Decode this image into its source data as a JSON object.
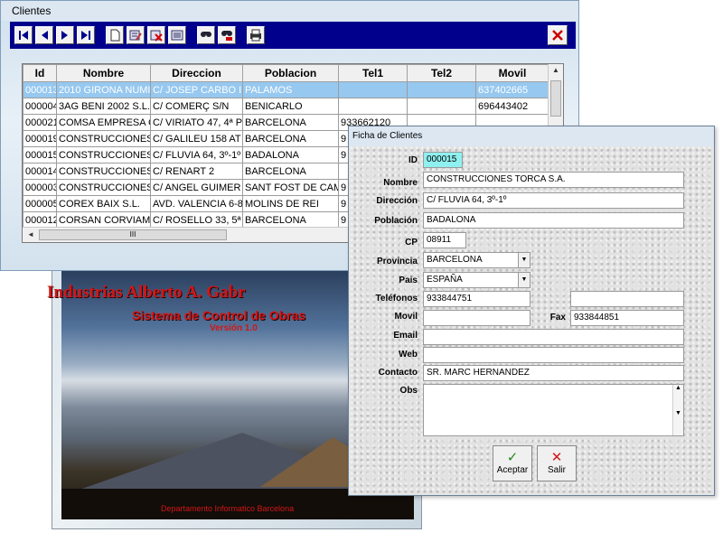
{
  "clientes_window": {
    "title": "Clientes",
    "toolbar": {
      "icons": [
        "first-icon",
        "prev-icon",
        "next-icon",
        "last-icon",
        "new-icon",
        "edit-icon",
        "delete-icon",
        "list-icon",
        "search-icon",
        "search-filter-icon",
        "print-icon",
        "close-icon"
      ]
    },
    "grid": {
      "columns": [
        "Id",
        "Nombre",
        "Direccion",
        "Poblacion",
        "Tel1",
        "Tel2",
        "Movil"
      ],
      "rows": [
        [
          "000013",
          "2010 GIRONA NUMI",
          "C/ JOSEP CARBO I",
          "PALAMOS",
          "",
          "",
          "637402665"
        ],
        [
          "000004",
          "3AG BENI 2002 S.L.",
          "C/ COMERÇ S/N",
          "BENICARLO",
          "",
          "",
          "696443402"
        ],
        [
          "000021",
          "COMSA EMPRESA C",
          "C/ VIRIATO 47, 4ª P",
          "BARCELONA",
          "933662120",
          "",
          ""
        ],
        [
          "000019",
          "CONSTRUCCIONES",
          "C/ GALILEU 158 AT",
          "BARCELONA",
          "9",
          "",
          ""
        ],
        [
          "000015",
          "CONSTRUCCIONES",
          "C/ FLUVIA 64, 3º-1º",
          "BADALONA",
          "9",
          "",
          ""
        ],
        [
          "000014",
          "CONSTRUCCIONES",
          "C/ RENART 2",
          "BARCELONA",
          "",
          "",
          ""
        ],
        [
          "000003",
          "CONSTRUCCIONES",
          "C/ ANGEL GUIMER",
          "SANT FOST DE CAM",
          "9",
          "",
          ""
        ],
        [
          "000005",
          "COREX BAIX S.L.",
          "AVD. VALENCIA 6-8",
          "MOLINS DE REI",
          "9",
          "",
          ""
        ],
        [
          "000012",
          "CORSAN CORVIAM C",
          "C/ ROSELLO 33, 5ª",
          "BARCELONA",
          "9",
          "",
          ""
        ]
      ],
      "hscroll_thumb": "III"
    }
  },
  "splash": {
    "title": "Industrias Alberto A. Gabr",
    "subtitle": "Sistema de Control de Obras",
    "version": "Versión 1.0",
    "footer": "Departamento Informatico Barcelona"
  },
  "ficha": {
    "title": "Ficha de Clientes",
    "labels": {
      "id": "ID",
      "nombre": "Nombre",
      "direccion": "Dirección",
      "poblacion": "Población",
      "cp": "CP",
      "provincia": "Provincia",
      "pais": "Pais",
      "telefonos": "Teléfonos",
      "movil": "Movil",
      "fax": "Fax",
      "email": "Email",
      "web": "Web",
      "contacto": "Contacto",
      "obs": "Obs"
    },
    "values": {
      "id": "000015",
      "nombre": "CONSTRUCCIONES TORCA S.A.",
      "direccion": "C/ FLUVIA 64, 3º-1º",
      "poblacion": "BADALONA",
      "cp": "08911",
      "provincia": "BARCELONA",
      "pais": "ESPAÑA",
      "telefono1": "933844751",
      "telefono2": "",
      "movil": "",
      "fax": "933844851",
      "email": "",
      "web": "",
      "contacto": "SR. MARC HERNANDEZ",
      "obs": ""
    },
    "buttons": {
      "aceptar": "Aceptar",
      "salir": "Salir"
    },
    "colors": {
      "id_field_bg": "#8ff0f0",
      "aceptar_glyph": "#1f8a1f",
      "salir_glyph": "#d01818"
    }
  }
}
